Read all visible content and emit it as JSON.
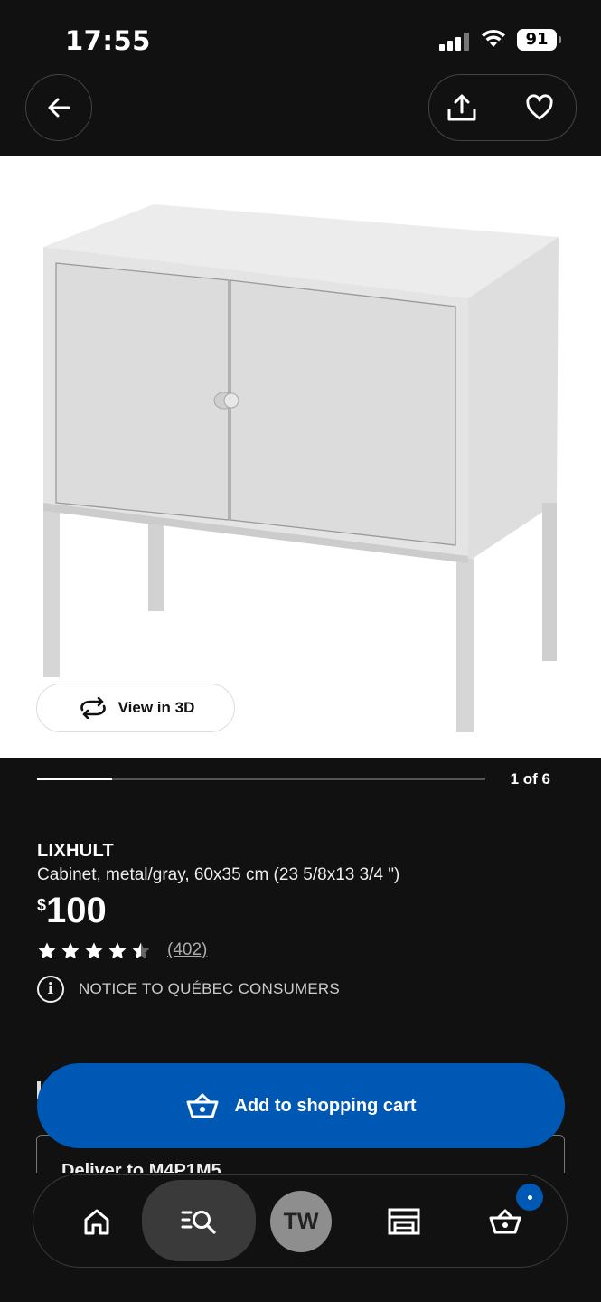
{
  "status_bar": {
    "time": "17:55",
    "battery": "91"
  },
  "carousel": {
    "label": "1 of 6",
    "progress": 0.167
  },
  "image": {
    "view3d_label": "View in 3D"
  },
  "product": {
    "name": "LIXHULT",
    "description": "Cabinet, metal/gray, 60x35 cm (23 5/8x13 3/4 \")",
    "price_currency": "$",
    "price_amount": "100",
    "rating": 4.5,
    "review_count": "(402)",
    "notice": "NOTICE TO QUÉBEC CONSUMERS"
  },
  "cta": {
    "add_to_cart": "Add to shopping cart"
  },
  "delivery": {
    "label": "Deliver to M4P1M5"
  },
  "bottom_nav": {
    "profile_initials": "TW"
  },
  "colors": {
    "accent": "#0058b5",
    "background": "#111111"
  }
}
